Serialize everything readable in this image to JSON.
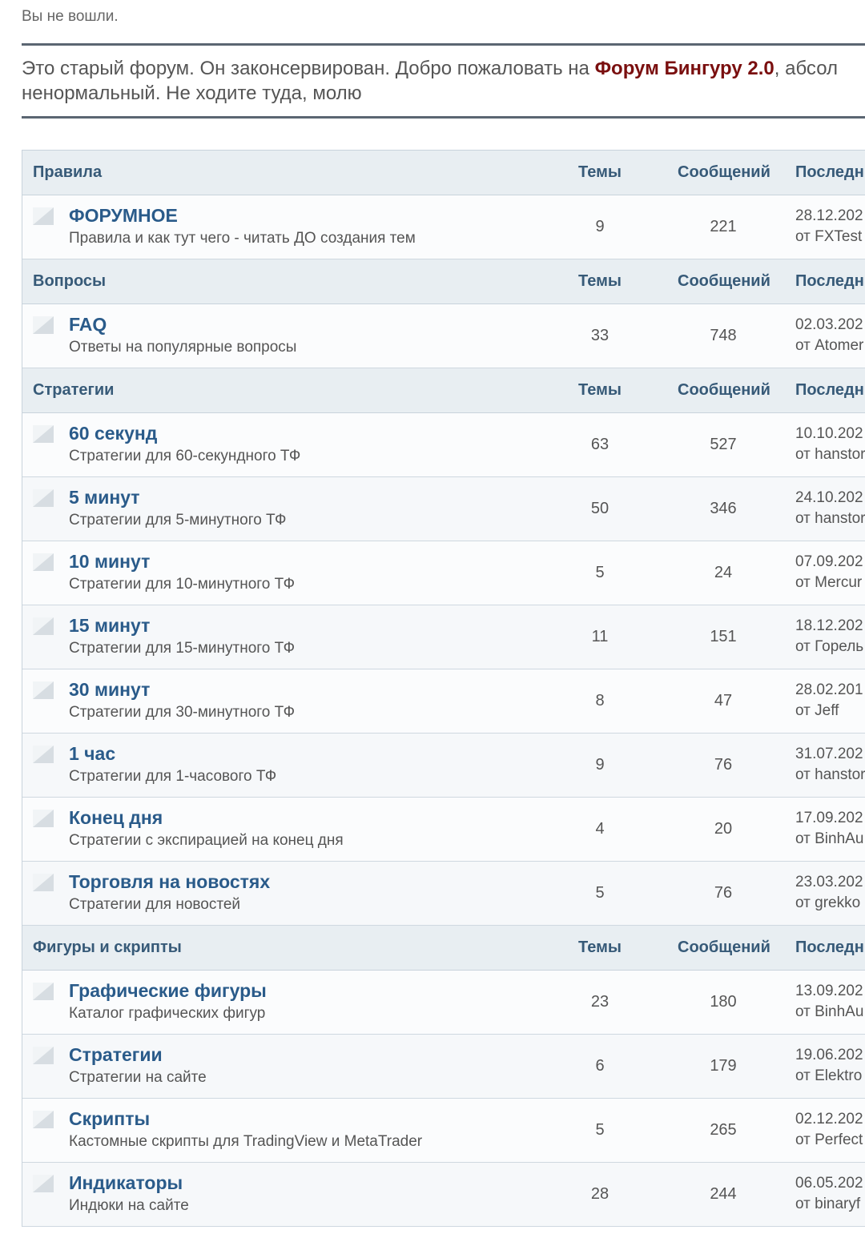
{
  "status_text": "Вы не вошли.",
  "notice": {
    "text_before": "Это старый форум. Он законсервирован. Добро пожаловать на ",
    "link_text": "Форум Бингуру 2.0",
    "text_after": ", абсол",
    "line2": "ненормальный. Не ходите туда, молю"
  },
  "columns": {
    "topics": "Темы",
    "posts": "Сообщений",
    "last": "Последн"
  },
  "categories": [
    {
      "name": "Правила",
      "forums": [
        {
          "name": "ФОРУМНОЕ",
          "desc": "Правила и как тут чего - читать ДО создания тем",
          "topics": "9",
          "posts": "221",
          "last_date": "28.12.202",
          "last_by": "от FXTest"
        }
      ]
    },
    {
      "name": "Вопросы",
      "forums": [
        {
          "name": "FAQ",
          "desc": "Ответы на популярные вопросы",
          "topics": "33",
          "posts": "748",
          "last_date": "02.03.202",
          "last_by": "от Atomer"
        }
      ]
    },
    {
      "name": "Стратегии",
      "forums": [
        {
          "name": "60 секунд",
          "desc": "Стратегии для 60-секундного ТФ",
          "topics": "63",
          "posts": "527",
          "last_date": "10.10.202",
          "last_by": "от hanstor"
        },
        {
          "name": "5 минут",
          "desc": "Стратегии для 5-минутного ТФ",
          "topics": "50",
          "posts": "346",
          "last_date": "24.10.202",
          "last_by": "от hanstor"
        },
        {
          "name": "10 минут",
          "desc": "Стратегии для 10-минутного ТФ",
          "topics": "5",
          "posts": "24",
          "last_date": "07.09.202",
          "last_by": "от Mercur"
        },
        {
          "name": "15 минут",
          "desc": "Стратегии для 15-минутного ТФ",
          "topics": "11",
          "posts": "151",
          "last_date": "18.12.202",
          "last_by": "от Горель"
        },
        {
          "name": "30 минут",
          "desc": "Стратегии для 30-минутного ТФ",
          "topics": "8",
          "posts": "47",
          "last_date": "28.02.201",
          "last_by": "от Jeff"
        },
        {
          "name": "1 час",
          "desc": "Стратегии для 1-часового ТФ",
          "topics": "9",
          "posts": "76",
          "last_date": "31.07.202",
          "last_by": "от hanstor"
        },
        {
          "name": "Конец дня",
          "desc": "Стратегии с экспирацией на конец дня",
          "topics": "4",
          "posts": "20",
          "last_date": "17.09.202",
          "last_by": "от BinhAu"
        },
        {
          "name": "Торговля на новостях",
          "desc": "Стратегии для новостей",
          "topics": "5",
          "posts": "76",
          "last_date": "23.03.202",
          "last_by": "от grekko"
        }
      ]
    },
    {
      "name": "Фигуры и скрипты",
      "forums": [
        {
          "name": "Графические фигуры",
          "desc": "Каталог графических фигур",
          "topics": "23",
          "posts": "180",
          "last_date": "13.09.202",
          "last_by": "от BinhAu"
        },
        {
          "name": "Стратегии",
          "desc": "Стратегии на сайте",
          "topics": "6",
          "posts": "179",
          "last_date": "19.06.202",
          "last_by": "от Elektro"
        },
        {
          "name": "Скрипты",
          "desc": "Кастомные скрипты для TradingView и MetaTrader",
          "topics": "5",
          "posts": "265",
          "last_date": "02.12.202",
          "last_by": "от Perfect"
        },
        {
          "name": "Индикаторы",
          "desc": "Индюки на сайте",
          "topics": "28",
          "posts": "244",
          "last_date": "06.05.202",
          "last_by": "от binaryf"
        }
      ]
    }
  ]
}
